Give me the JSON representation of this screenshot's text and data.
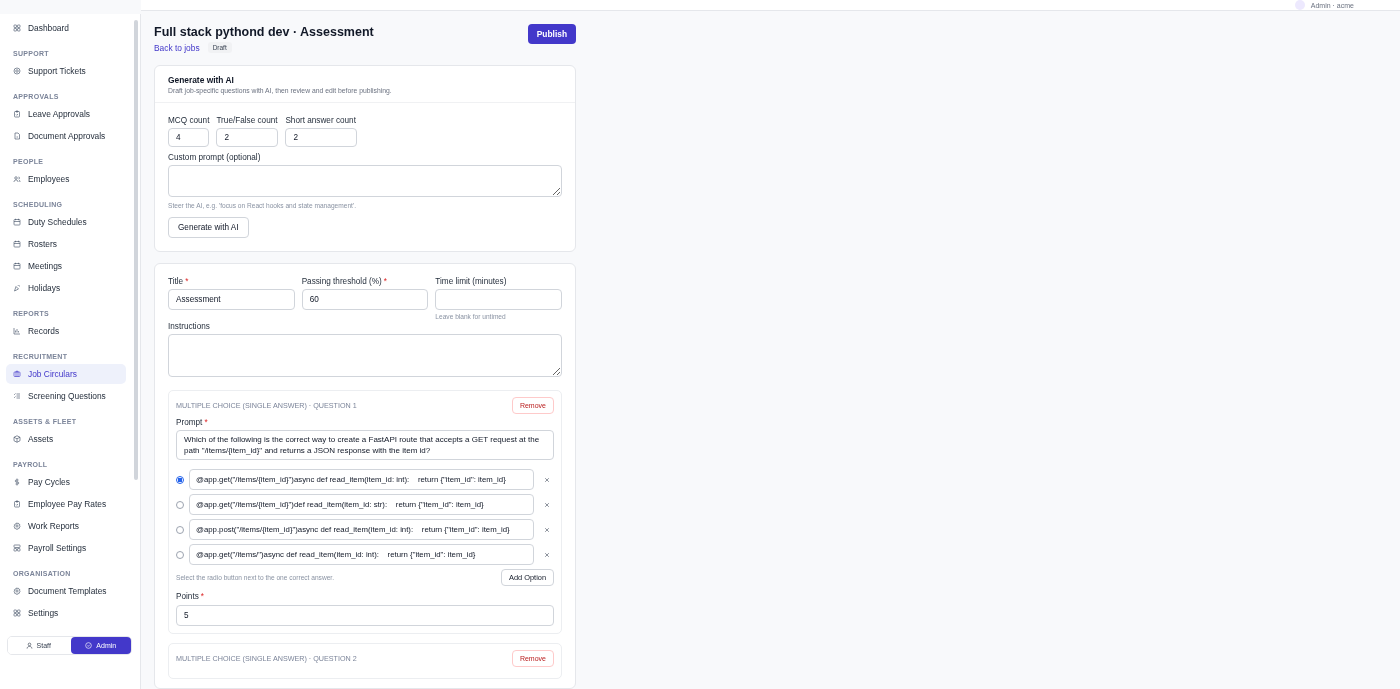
{
  "user": {
    "label": "Admin · acme"
  },
  "sidebar": {
    "sections": [
      {
        "items": [
          {
            "label": "Dashboard",
            "selected": false
          }
        ]
      },
      {
        "label": "SUPPORT",
        "items": [
          {
            "label": "Support Tickets",
            "selected": false
          }
        ]
      },
      {
        "label": "APPROVALS",
        "items": [
          {
            "label": "Leave Approvals",
            "selected": false
          },
          {
            "label": "Document Approvals",
            "selected": false
          }
        ]
      },
      {
        "label": "PEOPLE",
        "items": [
          {
            "label": "Employees",
            "selected": false
          }
        ]
      },
      {
        "label": "SCHEDULING",
        "items": [
          {
            "label": "Duty Schedules",
            "selected": false
          },
          {
            "label": "Rosters",
            "selected": false
          },
          {
            "label": "Meetings",
            "selected": false
          },
          {
            "label": "Holidays",
            "selected": false
          }
        ]
      },
      {
        "label": "REPORTS",
        "items": [
          {
            "label": "Records",
            "selected": false
          }
        ]
      },
      {
        "label": "RECRUITMENT",
        "items": [
          {
            "label": "Job Circulars",
            "selected": true
          },
          {
            "label": "Screening Questions",
            "selected": false
          }
        ]
      },
      {
        "label": "ASSETS & FLEET",
        "items": [
          {
            "label": "Assets",
            "selected": false
          }
        ]
      },
      {
        "label": "PAYROLL",
        "items": [
          {
            "label": "Pay Cycles",
            "selected": false
          },
          {
            "label": "Employee Pay Rates",
            "selected": false
          },
          {
            "label": "Work Reports",
            "selected": false
          },
          {
            "label": "Payroll Settings",
            "selected": false
          }
        ]
      },
      {
        "label": "ORGANISATION",
        "items": [
          {
            "label": "Document Templates",
            "selected": false
          },
          {
            "label": "Settings",
            "selected": false
          }
        ]
      }
    ],
    "roles": [
      {
        "label": "Staff",
        "selected": false
      },
      {
        "label": "Admin",
        "selected": true
      }
    ]
  },
  "page": {
    "title": "Full stack pythond dev · Assessment",
    "back_link": "Back to jobs",
    "status": "Draft",
    "publish_button": "Publish"
  },
  "ai_card": {
    "title": "Generate with AI",
    "subtitle": "Draft job-specific questions with AI, then review and edit before publishing.",
    "counts": [
      {
        "label": "MCQ count",
        "value": "4"
      },
      {
        "label": "True/False count",
        "value": "2"
      },
      {
        "label": "Short answer count",
        "value": "2"
      }
    ],
    "custom_prompt_label": "Custom prompt (optional)",
    "custom_prompt_hint": "Steer the AI, e.g. 'focus on React hooks and state management'.",
    "generate_button": "Generate with AI"
  },
  "form": {
    "fields": [
      {
        "label": "Title",
        "required_mark": "*",
        "value": "Assessment"
      },
      {
        "label": "Passing threshold (%)",
        "required_mark": "*",
        "value": "60"
      },
      {
        "label": "Time limit (minutes)",
        "hint": "Leave blank for untimed"
      }
    ],
    "instructions_label": "Instructions",
    "questions": [
      {
        "heading": "MULTIPLE CHOICE (SINGLE ANSWER) · QUESTION 1",
        "remove_button": "Remove",
        "prompt_label": "Prompt",
        "prompt_required_mark": "*",
        "prompt": "Which of the following is the correct way to create a FastAPI route that accepts a GET request at the path \"/items/{item_id}\" and returns a JSON response with the item id?",
        "options": [
          {
            "text": "@app.get(\"/items/{item_id}\")async def read_item(item_id: int):    return {\"item_id\": item_id}",
            "selected": true
          },
          {
            "text": "@app.get(\"/items/{item_id}\")def read_item(item_id: str):    return {\"item_id\": item_id}",
            "selected": false
          },
          {
            "text": "@app.post(\"/items/{item_id}\")async def read_item(item_id: int):    return {\"item_id\": item_id}",
            "selected": false
          },
          {
            "text": "@app.get(\"/items/\")async def read_item(item_id: int):    return {\"item_id\": item_id}",
            "selected": false
          }
        ],
        "hint": "Select the radio button next to the one correct answer.",
        "add_option_button": "Add Option",
        "points_label": "Points",
        "points_required_mark": "*",
        "points": "5"
      },
      {
        "heading": "MULTIPLE CHOICE (SINGLE ANSWER) · QUESTION 2",
        "remove_button": "Remove"
      }
    ]
  }
}
